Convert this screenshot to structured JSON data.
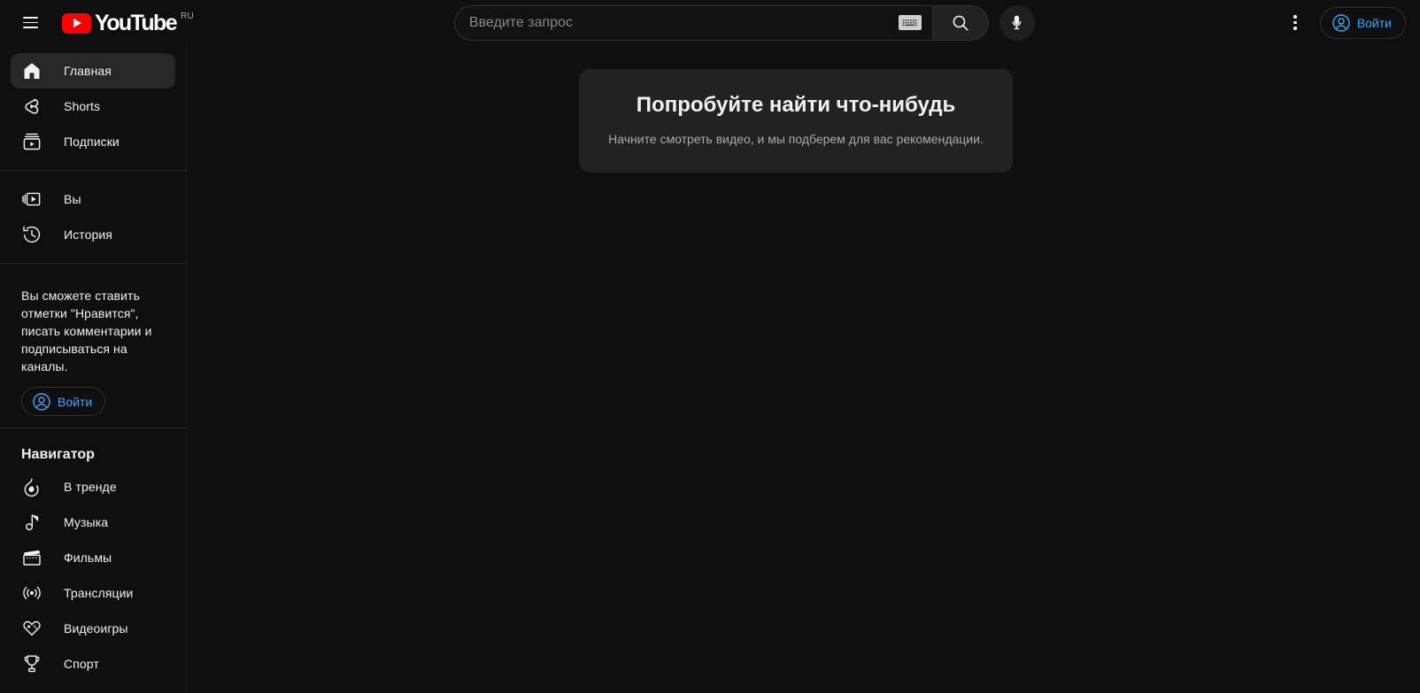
{
  "header": {
    "menu_icon": "hamburger-menu-icon",
    "logo_text": "YouTube",
    "logo_country": "RU",
    "search": {
      "placeholder": "Введите запрос",
      "value": "",
      "keyboard_icon": "keyboard-icon",
      "search_icon": "search-icon",
      "mic_icon": "microphone-icon"
    },
    "more_icon": "kebab-menu-icon",
    "signin_label": "Войти",
    "signin_icon": "account-circle-icon",
    "accent_color": "#3ea6ff"
  },
  "sidebar": {
    "primary_items": [
      {
        "label": "Главная",
        "icon": "home-icon",
        "active": true
      },
      {
        "label": "Shorts",
        "icon": "shorts-icon",
        "active": false
      },
      {
        "label": "Подписки",
        "icon": "subscriptions-icon",
        "active": false
      }
    ],
    "secondary_items": [
      {
        "label": "Вы",
        "icon": "you-library-icon",
        "active": false
      },
      {
        "label": "История",
        "icon": "history-clock-icon",
        "active": false
      }
    ],
    "promo": {
      "text": "Вы сможете ставить отметки \"Нравится\", писать комментарии и подписываться на каналы.",
      "button_label": "Войти",
      "button_icon": "account-circle-icon"
    },
    "explore": {
      "title": "Навигатор",
      "items": [
        {
          "label": "В тренде",
          "icon": "trending-fire-icon"
        },
        {
          "label": "Музыка",
          "icon": "music-note-icon"
        },
        {
          "label": "Фильмы",
          "icon": "movie-clapper-icon"
        },
        {
          "label": "Трансляции",
          "icon": "live-broadcast-icon"
        },
        {
          "label": "Видеоигры",
          "icon": "gaming-controller-icon"
        },
        {
          "label": "Спорт",
          "icon": "sports-trophy-icon"
        }
      ]
    }
  },
  "main": {
    "card": {
      "title": "Попробуйте найти что-нибудь",
      "subtitle": "Начните смотреть видео, и мы подберем для вас рекомендации."
    }
  },
  "colors": {
    "background": "#0f0f0f",
    "card": "#222222",
    "active_item": "#272727",
    "brand_red": "#ff0000",
    "accent_blue": "#3ea6ff",
    "muted_text": "#aaaaaa"
  }
}
